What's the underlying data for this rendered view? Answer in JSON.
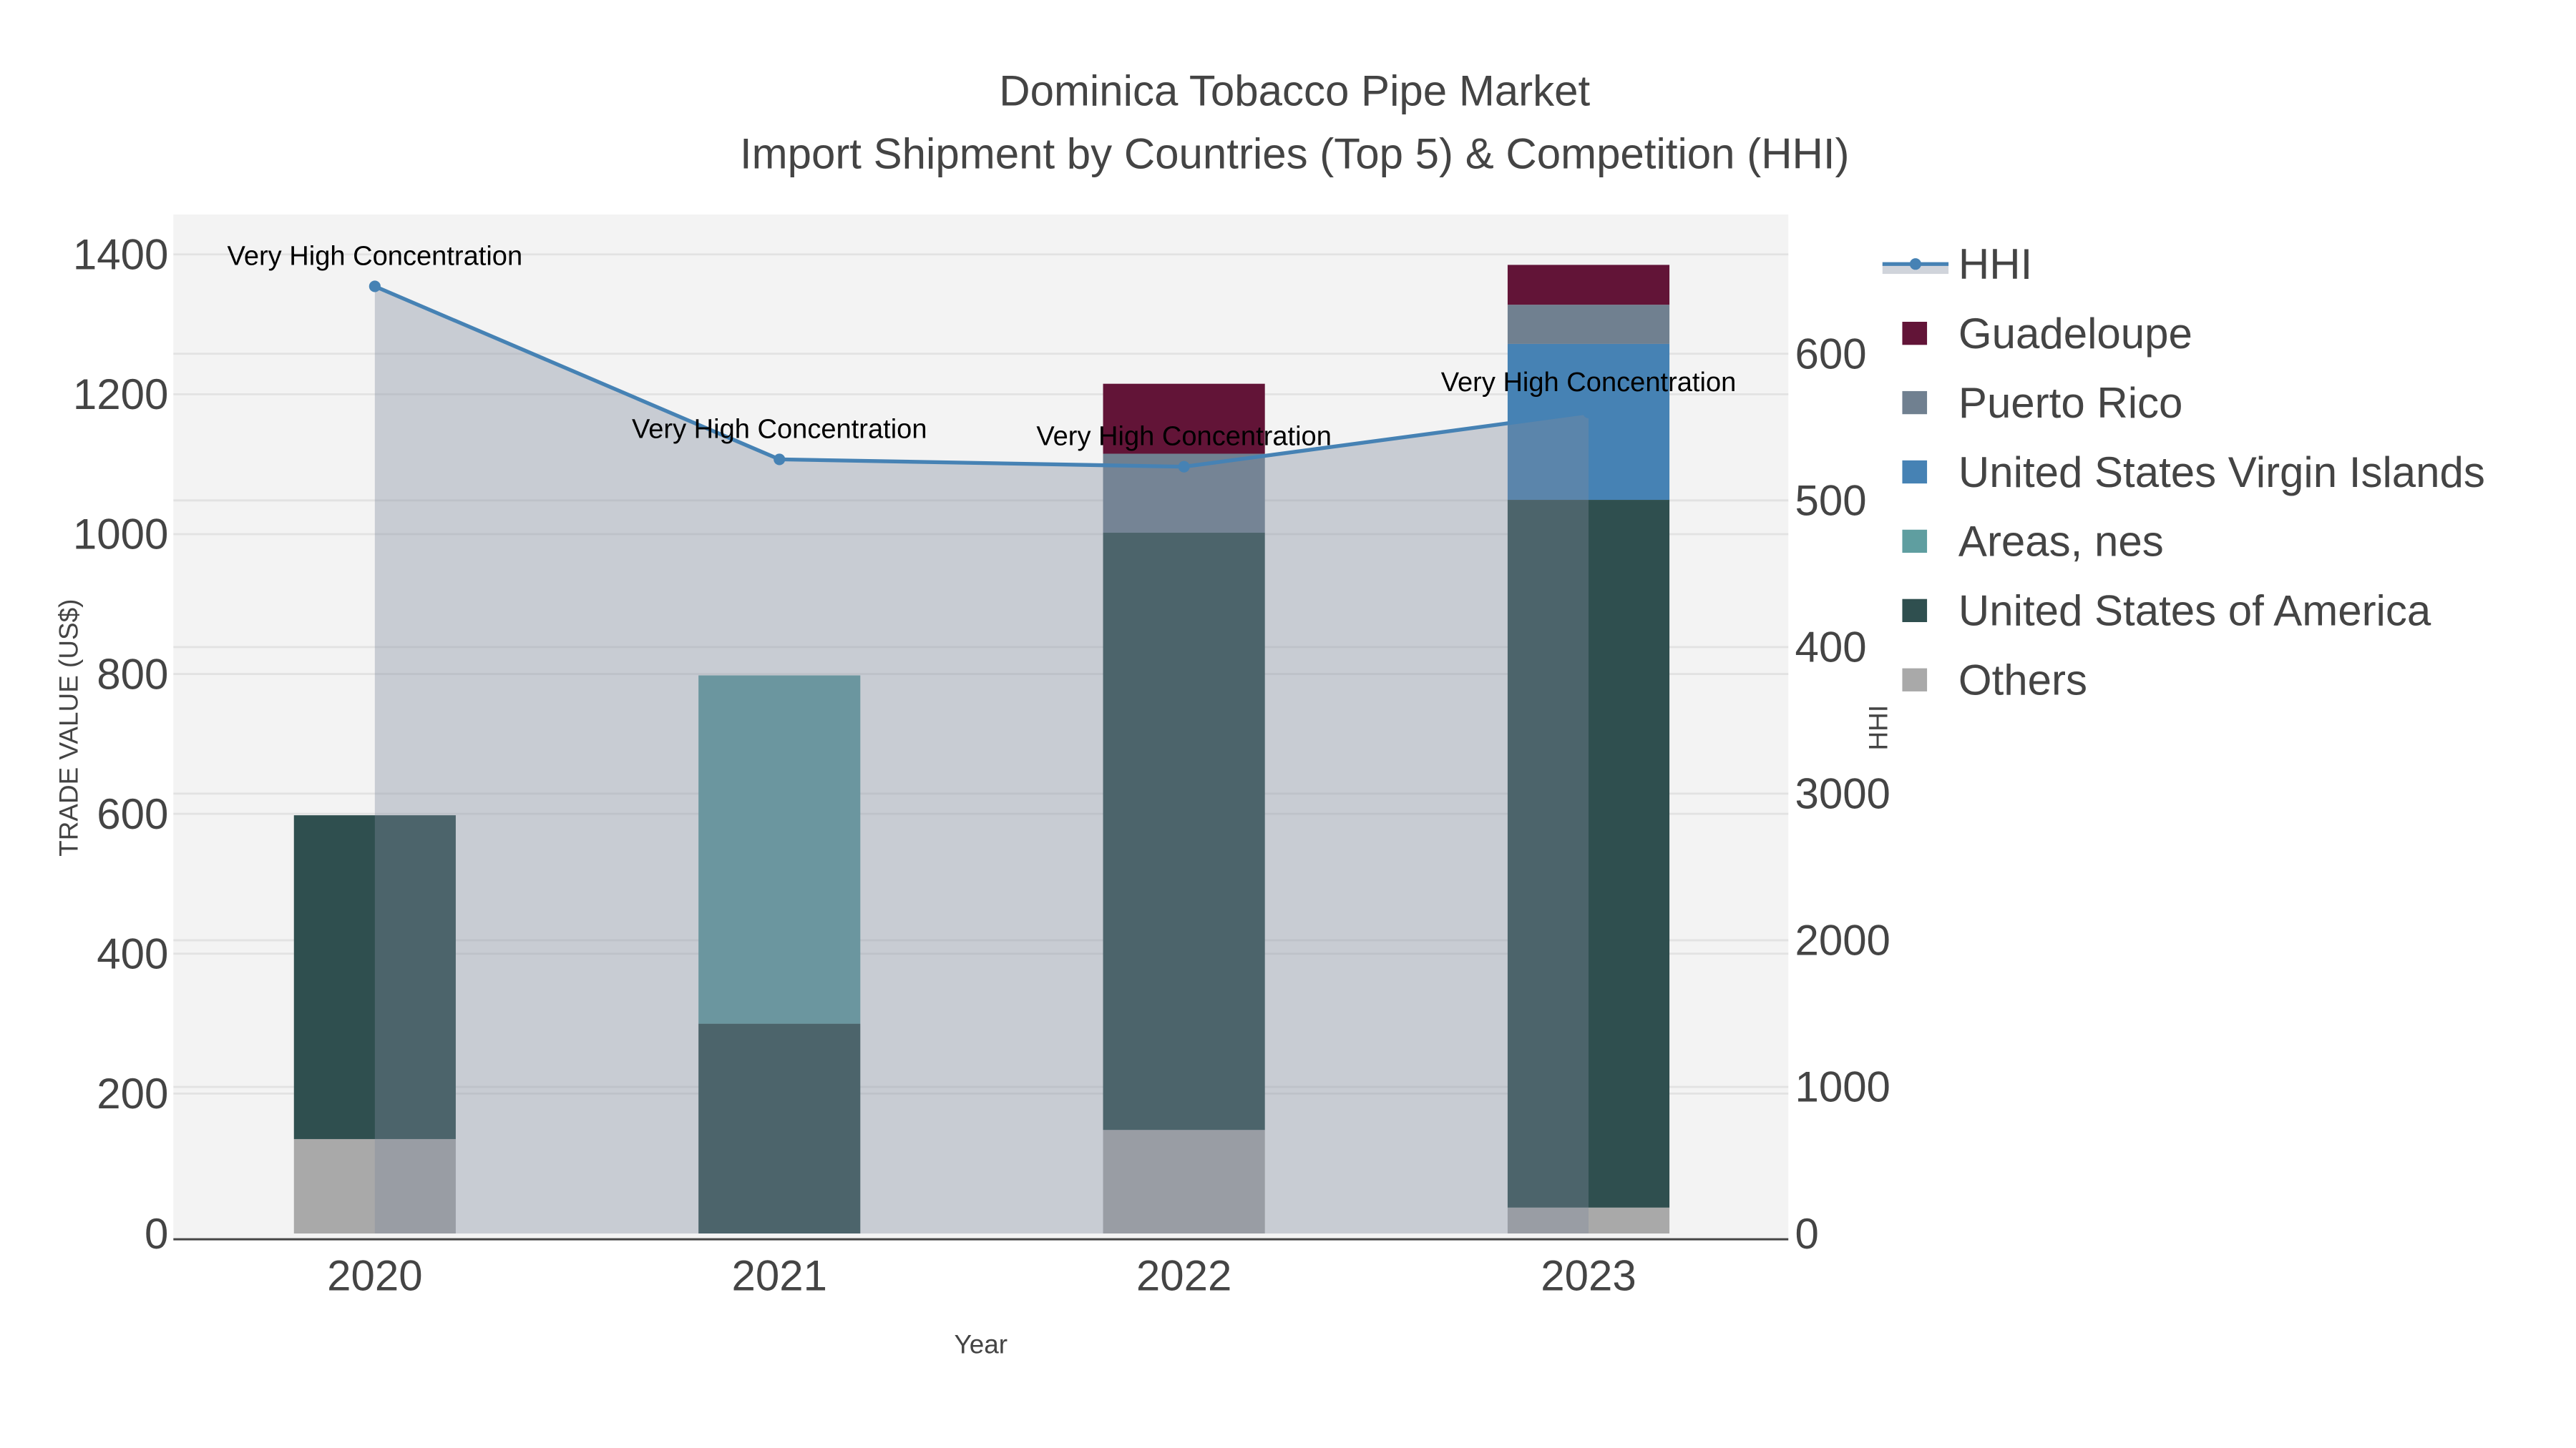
{
  "chart_data": {
    "type": "bar",
    "title": "Dominica Tobacco Pipe Market",
    "subtitle": "Import Shipment by Countries (Top 5) & Competition (HHI)",
    "xlabel": "Year",
    "ylabel": "TRADE VALUE (US$)",
    "y2label": "HHI",
    "categories": [
      "2020",
      "2021",
      "2022",
      "2023"
    ],
    "ylim": [
      0,
      1457
    ],
    "yticks": [
      0,
      200,
      400,
      600,
      800,
      1000,
      1200,
      1400
    ],
    "ytick_labels": [
      "0",
      "200",
      "400",
      "600",
      "800",
      "1000",
      "1200",
      "1400"
    ],
    "y2lim": [
      0,
      6950
    ],
    "y2ticks": [
      0,
      1000,
      2000,
      3000,
      4000,
      5000,
      6000
    ],
    "y2tick_labels": [
      "0",
      "1000",
      "2000",
      "3000",
      "400",
      "500",
      "600"
    ],
    "grid": true,
    "legend_position": "right",
    "series": [
      {
        "name": "Others",
        "color": "#a9a9a9",
        "values": [
          135,
          0,
          148,
          37
        ]
      },
      {
        "name": "United States of America",
        "color": "#2f4f4f",
        "values": [
          463,
          300,
          854,
          1012
        ]
      },
      {
        "name": "Areas, nes",
        "color": "#5f9ea0",
        "values": [
          0,
          498,
          0,
          0
        ]
      },
      {
        "name": "United States Virgin Islands",
        "color": "#4682b4",
        "values": [
          0,
          0,
          0,
          223
        ]
      },
      {
        "name": "Puerto Rico",
        "color": "#708090",
        "values": [
          0,
          0,
          113,
          56
        ]
      },
      {
        "name": "Guadeloupe",
        "color": "#621437",
        "values": [
          0,
          0,
          100,
          57
        ]
      }
    ],
    "hhi": {
      "name": "HHI",
      "color": "#4682b4",
      "fill_color": "rgba(127,138,157,0.37)",
      "values": [
        6460,
        5280,
        5230,
        5600
      ],
      "annotations": [
        "Very High Concentration",
        "Very High Concentration",
        "Very High Concentration",
        "Very High Concentration"
      ]
    },
    "legend_order": [
      "HHI",
      "Guadeloupe",
      "Puerto Rico",
      "United States Virgin Islands",
      "Areas, nes",
      "United States of America",
      "Others"
    ]
  }
}
